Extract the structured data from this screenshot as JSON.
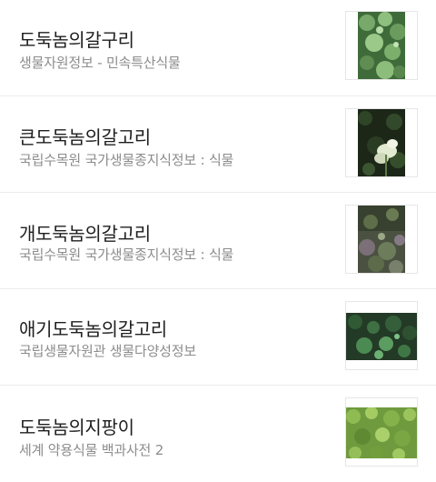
{
  "results": [
    {
      "title": "도둑놈의갈구리",
      "source": "생물자원정보 - 민속특산식물",
      "thumbnail_icon": "plant-photo-icon"
    },
    {
      "title": "큰도둑놈의갈고리",
      "source": "국립수목원 국가생물종지식정보 : 식물",
      "thumbnail_icon": "plant-photo-icon"
    },
    {
      "title": "개도둑놈의갈고리",
      "source": "국립수목원 국가생물종지식정보 : 식물",
      "thumbnail_icon": "plant-photo-icon"
    },
    {
      "title": "애기도둑놈의갈고리",
      "source": "국립생물자원관 생물다양성정보",
      "thumbnail_icon": "plant-photo-icon"
    },
    {
      "title": "도둑놈의지팡이",
      "source": "세계 약용식물 백과사전 2",
      "thumbnail_icon": "plant-photo-icon"
    }
  ]
}
